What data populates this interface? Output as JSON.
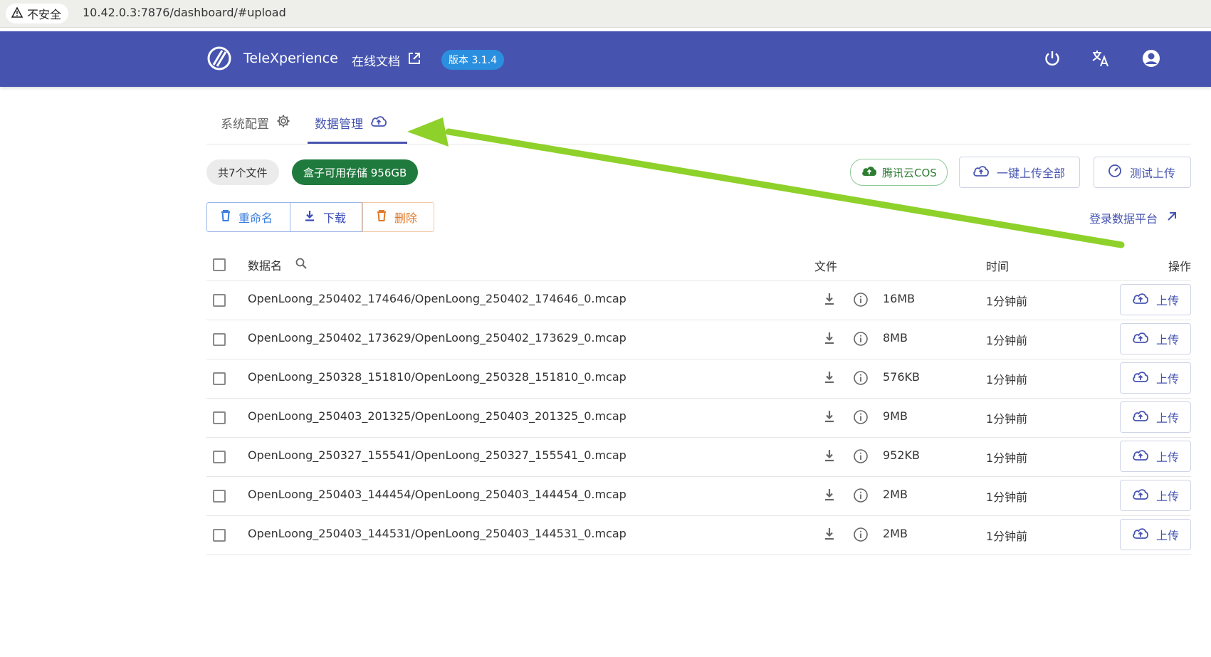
{
  "browser": {
    "insecure_label": "不安全",
    "url": "10.42.0.3:7876/dashboard/#upload"
  },
  "header": {
    "app_name": "TeleXperience",
    "docs_label": "在线文档",
    "version": "版本 3.1.4",
    "bg_color": "#4654b0"
  },
  "tabs": [
    {
      "label": "系统配置",
      "icon": "gear-icon",
      "active": false
    },
    {
      "label": "数据管理",
      "icon": "cloud-upload-icon",
      "active": true
    }
  ],
  "summary": {
    "total": "共7个文件",
    "storage": "盒子可用存储 956GB"
  },
  "toolbar": {
    "cos_label": "腾讯云COS",
    "upload_all_label": "一键上传全部",
    "test_upload_label": "测试上传",
    "rename_label": "重命名",
    "download_label": "下载",
    "delete_label": "删除",
    "platform_label": "登录数据平台"
  },
  "table": {
    "columns": {
      "name": "数据名",
      "file": "文件",
      "time": "时间",
      "op": "操作"
    },
    "upload_label": "上传",
    "rows": [
      {
        "name": "OpenLoong_250402_174646/OpenLoong_250402_174646_0.mcap",
        "size": "16MB",
        "time": "1分钟前"
      },
      {
        "name": "OpenLoong_250402_173629/OpenLoong_250402_173629_0.mcap",
        "size": "8MB",
        "time": "1分钟前"
      },
      {
        "name": "OpenLoong_250328_151810/OpenLoong_250328_151810_0.mcap",
        "size": "576KB",
        "time": "1分钟前"
      },
      {
        "name": "OpenLoong_250403_201325/OpenLoong_250403_201325_0.mcap",
        "size": "9MB",
        "time": "1分钟前"
      },
      {
        "name": "OpenLoong_250327_155541/OpenLoong_250327_155541_0.mcap",
        "size": "952KB",
        "time": "1分钟前"
      },
      {
        "name": "OpenLoong_250403_144454/OpenLoong_250403_144454_0.mcap",
        "size": "2MB",
        "time": "1分钟前"
      },
      {
        "name": "OpenLoong_250403_144531/OpenLoong_250403_144531_0.mcap",
        "size": "2MB",
        "time": "1分钟前"
      }
    ]
  },
  "annotation": {
    "arrow_color": "#8ed12a"
  }
}
